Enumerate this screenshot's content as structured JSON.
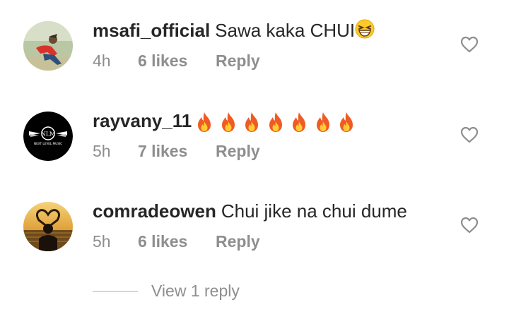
{
  "comments": [
    {
      "username": "msafi_official",
      "text": "Sawa kaka CHUI",
      "emoji": "grinning-squinting-face",
      "time": "4h",
      "likes": "6 likes",
      "reply_label": "Reply"
    },
    {
      "username": "rayvany_11",
      "text": "",
      "emoji": "fire",
      "emoji_count": 7,
      "avatar_label": "NLM",
      "avatar_sublabel": "NEXT LEVEL MUSIC",
      "time": "5h",
      "likes": "7 likes",
      "reply_label": "Reply"
    },
    {
      "username": "comradeowen",
      "text": "Chui jike na chui dume",
      "time": "5h",
      "likes": "6 likes",
      "reply_label": "Reply"
    }
  ],
  "view_replies": {
    "label": "View 1 reply"
  },
  "colors": {
    "text": "#262626",
    "secondary": "#8e8e8e",
    "rule": "#d6d6d6",
    "fire": "#f05a24"
  },
  "icons": {
    "like": "heart-outline-icon"
  }
}
